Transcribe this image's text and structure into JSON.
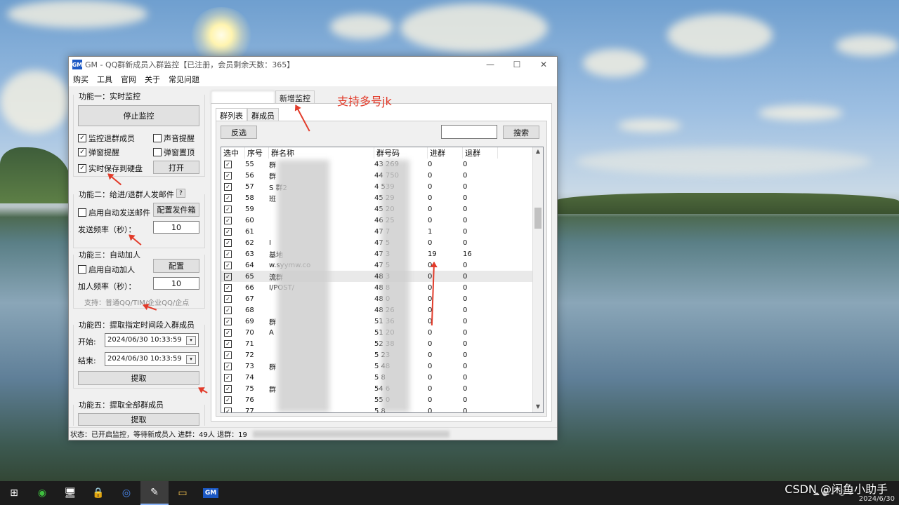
{
  "window": {
    "title": "GM - QQ群新成员入群监控【已注册，会员剩余天数：365】",
    "app_icon": "GM",
    "controls": [
      "—",
      "☐",
      "✕"
    ]
  },
  "menu": [
    "购买",
    "工具",
    "官网",
    "关于",
    "常见问题"
  ],
  "func1": {
    "title": "功能一：实时监控",
    "stop_button": "停止监控",
    "options": [
      {
        "label": "监控退群成员",
        "checked": true
      },
      {
        "label": "声音提醒",
        "checked": false
      },
      {
        "label": "弹窗提醒",
        "checked": true
      },
      {
        "label": "弹窗置顶",
        "checked": false
      },
      {
        "label": "实时保存到硬盘",
        "checked": true
      }
    ],
    "open_button": "打开"
  },
  "func2": {
    "title": "功能二：给进/退群人发邮件",
    "help": "?",
    "auto_mail": "启用自动发送邮件",
    "config_button": "配置发件箱",
    "freq_label": "发送频率（秒）：",
    "freq_value": "10"
  },
  "func3": {
    "title": "功能三：自动加人",
    "auto_add": "启用自动加人",
    "config_button": "配置",
    "freq_label": "加人频率（秒）：",
    "freq_value": "10",
    "support": "支持：普通QQ/TIM/企业QQ/企点"
  },
  "func4": {
    "title": "功能四：提取指定时间段入群成员",
    "start_label": "开始:",
    "start_value": "2024/06/30 10:33:59",
    "end_label": "结束:",
    "end_value": "2024/06/30 10:33:59",
    "extract_button": "提取"
  },
  "func5": {
    "title": "功能五：提取全部群成员",
    "extract_button": "提取"
  },
  "tabs": {
    "add_monitor": "新增监控",
    "sub_group_list": "群列表",
    "sub_members": "群成员"
  },
  "toolbar": {
    "invert_button": "反选",
    "search_button": "搜索",
    "search_value": ""
  },
  "table": {
    "headers": [
      "选中",
      "序号",
      "群名称",
      "群号码",
      "进群",
      "退群"
    ],
    "rows": [
      {
        "seq": "55",
        "name": "群",
        "num": "43 269",
        "in": "0",
        "out": "0"
      },
      {
        "seq": "56",
        "name": "群",
        "num": "44 750",
        "in": "0",
        "out": "0"
      },
      {
        "seq": "57",
        "name": "S 群2",
        "num": "4 539",
        "in": "0",
        "out": "0"
      },
      {
        "seq": "58",
        "name": "班",
        "num": "45 29",
        "in": "0",
        "out": "0"
      },
      {
        "seq": "59",
        "name": "",
        "num": "45 20",
        "in": "0",
        "out": "0"
      },
      {
        "seq": "60",
        "name": "",
        "num": "46 25",
        "in": "0",
        "out": "0"
      },
      {
        "seq": "61",
        "name": "",
        "num": "47 7",
        "in": "1",
        "out": "0"
      },
      {
        "seq": "62",
        "name": "I",
        "num": "47 5",
        "in": "0",
        "out": "0"
      },
      {
        "seq": "63",
        "name": "基地",
        "num": "47 3",
        "in": "19",
        "out": "16"
      },
      {
        "seq": "64",
        "name": "w.syymw.co",
        "num": "47 5",
        "in": "0",
        "out": "0"
      },
      {
        "seq": "65",
        "name": "流群",
        "num": "48 3",
        "in": "0",
        "out": "0"
      },
      {
        "seq": "66",
        "name": "I/POST/",
        "num": "48 8",
        "in": "0",
        "out": "0"
      },
      {
        "seq": "67",
        "name": "",
        "num": "48 0",
        "in": "0",
        "out": "0"
      },
      {
        "seq": "68",
        "name": "",
        "num": "48 26",
        "in": "0",
        "out": "0"
      },
      {
        "seq": "69",
        "name": "群",
        "num": "51 36",
        "in": "0",
        "out": "0"
      },
      {
        "seq": "70",
        "name": "A",
        "num": "51 20",
        "in": "0",
        "out": "0"
      },
      {
        "seq": "71",
        "name": "",
        "num": "52 38",
        "in": "0",
        "out": "0"
      },
      {
        "seq": "72",
        "name": "",
        "num": "5 23",
        "in": "0",
        "out": "0"
      },
      {
        "seq": "73",
        "name": "群",
        "num": "5 48",
        "in": "0",
        "out": "0"
      },
      {
        "seq": "74",
        "name": "",
        "num": "5 8",
        "in": "0",
        "out": "0"
      },
      {
        "seq": "75",
        "name": "群",
        "num": "54 6",
        "in": "0",
        "out": "0"
      },
      {
        "seq": "76",
        "name": "",
        "num": "55 0",
        "in": "0",
        "out": "0"
      },
      {
        "seq": "77",
        "name": "",
        "num": "5 8",
        "in": "0",
        "out": "0"
      }
    ]
  },
  "status": "状态：已开启监控，等待新成员入 进群：49人 退群：19",
  "annotation": "支持多号jk",
  "watermark": "CSDN @闲鱼小助手",
  "tray": {
    "date": "2024/6/30"
  },
  "colors": {
    "accent": "#e23b2a",
    "app_blue": "#1b58c4"
  }
}
